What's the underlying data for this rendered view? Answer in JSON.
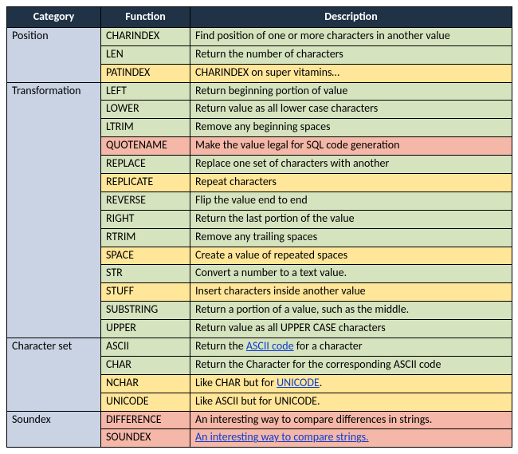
{
  "headers": {
    "category": "Category",
    "function": "Function",
    "description": "Description"
  },
  "groups": [
    {
      "category": "Position",
      "rows": [
        {
          "color": "green",
          "fn": "CHARINDEX",
          "desc_parts": [
            {
              "t": "Find position of one or more characters in another value"
            }
          ]
        },
        {
          "color": "green",
          "fn": "LEN",
          "desc_parts": [
            {
              "t": "Return the number of characters"
            }
          ]
        },
        {
          "color": "yellow",
          "fn": "PATINDEX",
          "desc_parts": [
            {
              "t": "CHARINDEX on super vitamins…"
            }
          ]
        }
      ]
    },
    {
      "category": "Transformation",
      "rows": [
        {
          "color": "green",
          "fn": "LEFT",
          "desc_parts": [
            {
              "t": "Return beginning portion of value"
            }
          ]
        },
        {
          "color": "green",
          "fn": "LOWER",
          "desc_parts": [
            {
              "t": "Return value as all lower case characters"
            }
          ]
        },
        {
          "color": "green",
          "fn": "LTRIM",
          "desc_parts": [
            {
              "t": "Remove any beginning spaces"
            }
          ]
        },
        {
          "color": "salmon",
          "fn": "QUOTENAME",
          "desc_parts": [
            {
              "t": "Make the value legal for SQL code generation"
            }
          ]
        },
        {
          "color": "green",
          "fn": "REPLACE",
          "desc_parts": [
            {
              "t": "Replace one set of characters with another"
            }
          ]
        },
        {
          "color": "yellow",
          "fn": "REPLICATE",
          "desc_parts": [
            {
              "t": "Repeat characters"
            }
          ]
        },
        {
          "color": "green",
          "fn": "REVERSE",
          "desc_parts": [
            {
              "t": "Flip the value end to end"
            }
          ]
        },
        {
          "color": "green",
          "fn": "RIGHT",
          "desc_parts": [
            {
              "t": "Return the last portion of the value"
            }
          ]
        },
        {
          "color": "green",
          "fn": "RTRIM",
          "desc_parts": [
            {
              "t": "Remove any trailing spaces"
            }
          ]
        },
        {
          "color": "yellow",
          "fn": "SPACE",
          "desc_parts": [
            {
              "t": "Create a value of repeated spaces"
            }
          ]
        },
        {
          "color": "green",
          "fn": "STR",
          "desc_parts": [
            {
              "t": "Convert a number to a text value."
            }
          ]
        },
        {
          "color": "yellow",
          "fn": "STUFF",
          "desc_parts": [
            {
              "t": "Insert characters inside another value"
            }
          ]
        },
        {
          "color": "green",
          "fn": "SUBSTRING",
          "desc_parts": [
            {
              "t": "Return a portion of a value, such as the middle."
            }
          ]
        },
        {
          "color": "green",
          "fn": "UPPER",
          "desc_parts": [
            {
              "t": "Return value as all UPPER CASE characters"
            }
          ]
        }
      ]
    },
    {
      "category": "Character set",
      "rows": [
        {
          "color": "green",
          "fn": "ASCII",
          "desc_parts": [
            {
              "t": "Return the "
            },
            {
              "t": "ASCII code",
              "link": true
            },
            {
              "t": " for a character"
            }
          ]
        },
        {
          "color": "green",
          "fn": "CHAR",
          "desc_parts": [
            {
              "t": "Return the Character for the corresponding ASCII code"
            }
          ]
        },
        {
          "color": "yellow",
          "fn": "NCHAR",
          "desc_parts": [
            {
              "t": "Like CHAR but for "
            },
            {
              "t": "UNICODE",
              "link": true
            },
            {
              "t": "."
            }
          ]
        },
        {
          "color": "yellow",
          "fn": "UNICODE",
          "desc_parts": [
            {
              "t": "Like ASCII but for UNICODE."
            }
          ]
        }
      ]
    },
    {
      "category": "Soundex",
      "rows": [
        {
          "color": "salmon",
          "fn": "DIFFERENCE",
          "desc_parts": [
            {
              "t": "An interesting way to compare differences in strings."
            }
          ]
        },
        {
          "color": "salmon",
          "fn": "SOUNDEX",
          "desc_parts": [
            {
              "t": "An interesting way to compare strings.",
              "link": true
            }
          ]
        }
      ]
    }
  ]
}
